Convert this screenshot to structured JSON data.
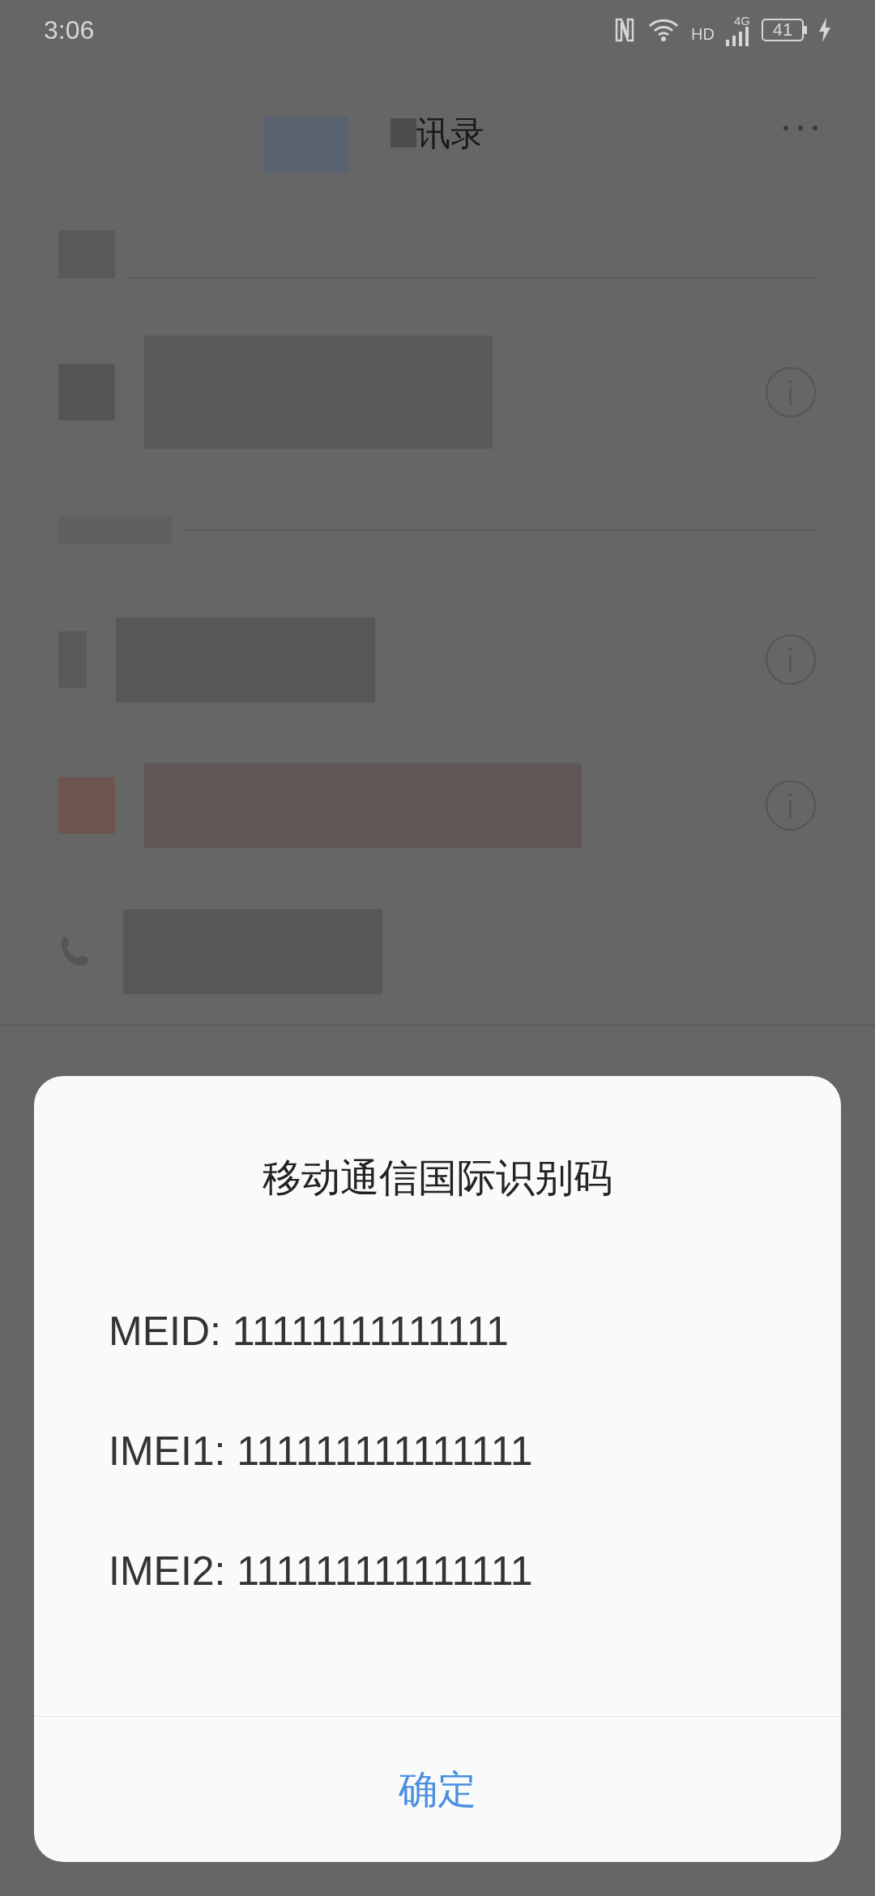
{
  "status_bar": {
    "time": "3:06",
    "hd": "HD",
    "network": "4G",
    "battery": "41"
  },
  "header": {
    "title": "讯录"
  },
  "dialog": {
    "title": "移动通信国际识别码",
    "lines": [
      "MEID: 11111111111111",
      "IMEI1: 111111111111111",
      "IMEI2: 111111111111111"
    ],
    "button": "确定"
  }
}
